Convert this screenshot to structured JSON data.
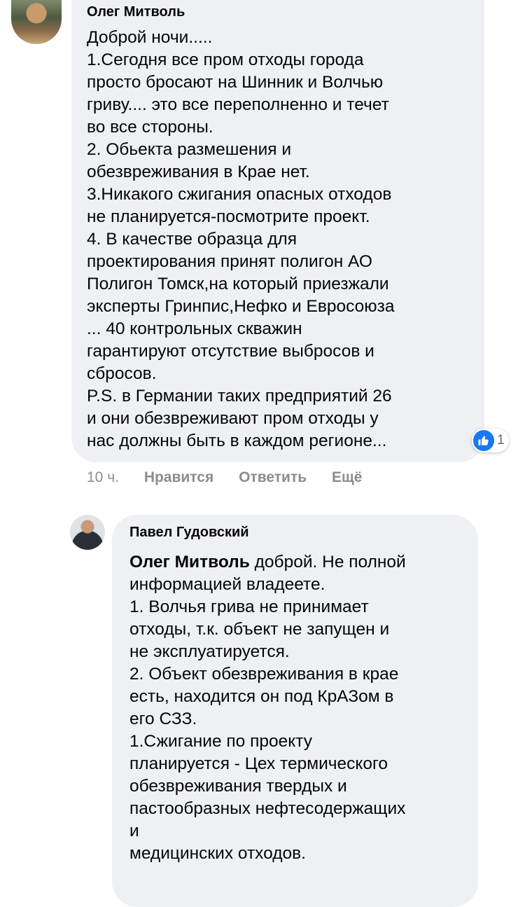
{
  "comment1": {
    "author": "Олег Митволь",
    "lines": [
      "Доброй ночи.....",
      "1.Сегодня все пром отходы города",
      "просто бросают на Шинник и Волчью",
      "гриву.... это все переполненно и течет",
      "во все стороны.",
      "2. Обьекта размешения и",
      "обезвреживания в Крае нет.",
      "3.Никакого сжигания опасных отходов",
      "не планируется-посмотрите проект.",
      "4. В качестве образца для",
      "проектирования принят полигон АО",
      "Полигон Томск,на который приезжали",
      "эксперты Гринпис,Нефко и Евросоюза",
      "... 40 контрольных скважин",
      "гарантируют отсутствие выбросов и",
      "сбросов.",
      "P.S. в Германии таких предприятий 26",
      "и они обезвреживают пром отходы у",
      "нас должны быть в каждом регионе..."
    ],
    "reaction": {
      "icon": "like-icon",
      "count": "1"
    },
    "actions": {
      "time": "10 ч.",
      "like": "Нравится",
      "reply": "Ответить",
      "more": "Ещё"
    }
  },
  "comment2": {
    "author": "Павел Гудовский",
    "mention": "Олег Митволь",
    "first_line_rest": " доброй. Не полной",
    "lines": [
      "информацией владеете.",
      "1. Волчья грива не принимает",
      "отходы, т.к. объект не запущен и",
      "не эксплуатируется.",
      "2. Объект обезвреживания в крае",
      "есть, находится он под КрАЗом в",
      "его СЗЗ.",
      "1.Сжигание по проекту",
      "планируется - Цех термического",
      "обезвреживания твердых и",
      "пастообразных нефтесодержащих",
      "и",
      "медицинских отходов."
    ]
  },
  "colors": {
    "bubble": "#eef0f3",
    "text": "#050505",
    "secondary": "#8a8d91",
    "like_blue": "#1877f2"
  }
}
